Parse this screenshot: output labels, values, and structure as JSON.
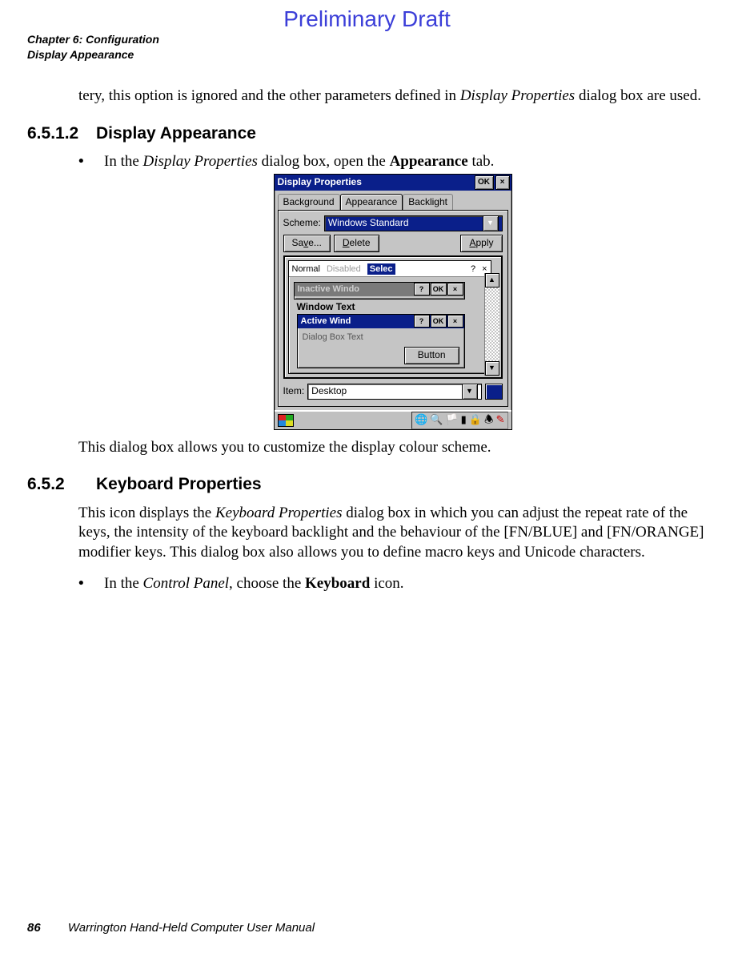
{
  "banner": "Preliminary Draft",
  "running_head": {
    "line1": "Chapter 6: Configuration",
    "line2": "Display Appearance"
  },
  "para_continuation": {
    "prefix": "tery, this option is ignored and the other parameters defined in ",
    "italic": "Display Properties",
    "suffix": " dialog box are used."
  },
  "sec_6512": {
    "num": "6.5.1.2",
    "title": "Display Appearance",
    "bullet_prefix": "In the ",
    "bullet_italic": "Display Properties",
    "bullet_mid": " dialog box, open the ",
    "bullet_bold": "Appearance",
    "bullet_suffix": " tab.",
    "caption": "This dialog box allows you to customize the display colour scheme."
  },
  "sec_652": {
    "num": "6.5.2",
    "title": "Keyboard Properties",
    "para_a": "This icon displays the ",
    "para_a_italic": "Keyboard Properties",
    "para_b": " dialog box in which you can adjust the repeat rate of the keys, the intensity of the keyboard backlight and the behaviour of the [FN/BLUE] and [FN/ORANGE] modifier keys. This dialog box also allows you to define macro keys and Unicode characters.",
    "bullet_prefix": "In the ",
    "bullet_italic": "Control Panel",
    "bullet_mid": ", choose the ",
    "bullet_bold": "Keyboard",
    "bullet_suffix": " icon."
  },
  "dialog": {
    "title": "Display Properties",
    "ok": "OK",
    "close": "×",
    "tabs": {
      "bg": "Background",
      "app": "Appearance",
      "bl": "Backlight"
    },
    "scheme_label": "Scheme:",
    "scheme_value": "Windows Standard",
    "save": "Save...",
    "delete": "Delete",
    "apply": "Apply",
    "menu": {
      "normal": "Normal",
      "disabled": "Disabled",
      "selected": "Selec"
    },
    "help": "?",
    "inactive": "Inactive Windo",
    "window_text": "Window Text",
    "active": "Active Wind",
    "dialog_text": "Dialog Box Text",
    "button": "Button",
    "item_label": "Item:",
    "item_value": "Desktop"
  },
  "footer": {
    "page": "86",
    "title": "Warrington Hand-Held Computer User Manual"
  }
}
